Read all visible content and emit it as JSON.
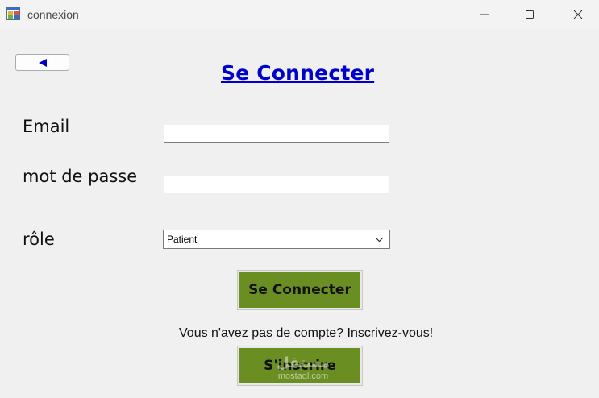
{
  "window": {
    "title": "connexion"
  },
  "header": {
    "back_label": "◄",
    "title": "Se Connecter"
  },
  "form": {
    "email_label": "Email",
    "email_value": "",
    "password_label": "mot de passe",
    "password_value": "",
    "role_label": "rôle",
    "role_selected": "Patient"
  },
  "actions": {
    "connect_label": "Se Connecter",
    "signup_prompt": "Vous n'avez pas de compte? Inscrivez-vous!",
    "register_label": "S'inscrire"
  },
  "watermark": {
    "main": "مستقل",
    "sub": "mostaql.com"
  },
  "colors": {
    "button_green": "#6b8e23",
    "title_blue": "#0000cc",
    "background": "#f0f0f0"
  }
}
